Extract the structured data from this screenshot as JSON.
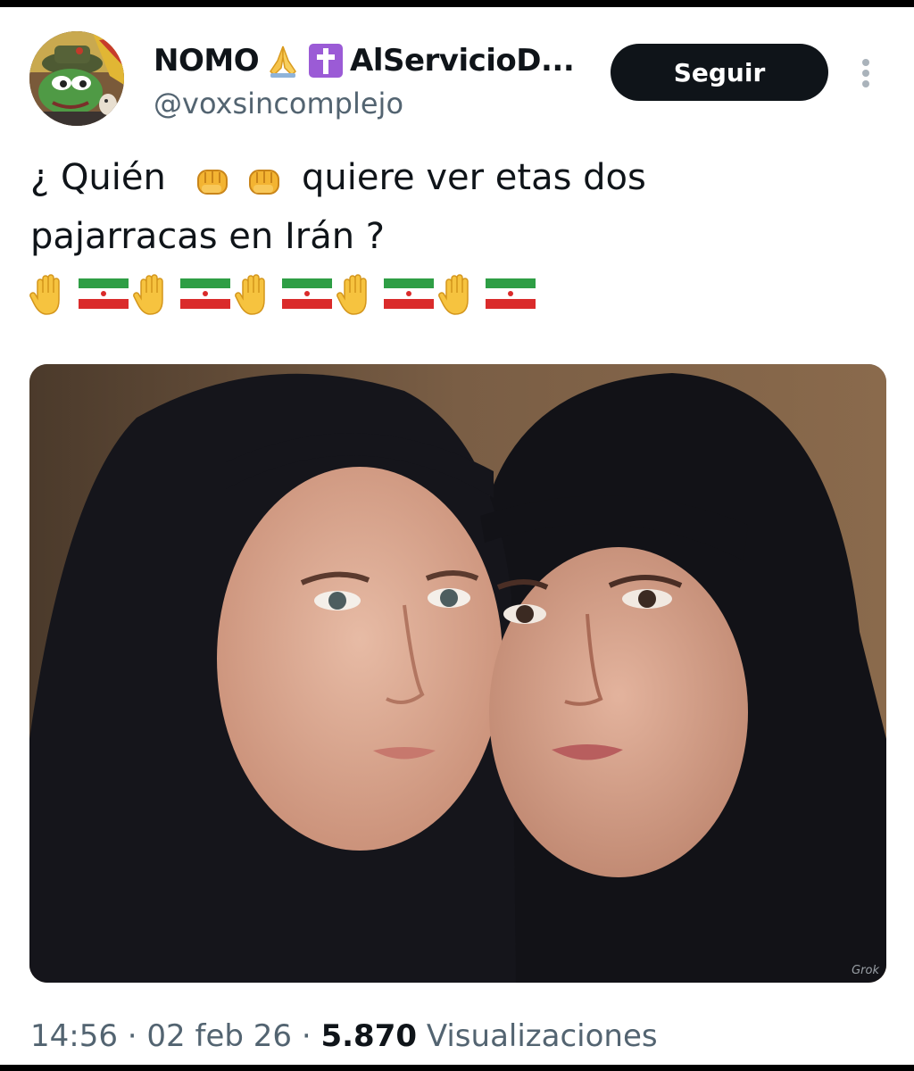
{
  "author": {
    "display_name_start": "NOMO",
    "display_name_end": "AlServicioD...",
    "handle": "@voxsincomplejo",
    "name_emojis": [
      "folded-hands-icon",
      "latin-cross-icon"
    ],
    "avatar": "pepe-frog-avatar"
  },
  "header": {
    "follow_label": "Seguir",
    "more_icon": "more-vertical-icon"
  },
  "tweet": {
    "line1_a": "¿ Quién",
    "line1_b": "quiere ver etas dos",
    "line2": "pajarracas en Irán ?",
    "line1_emojis": [
      "oncoming-fist-icon",
      "oncoming-fist-icon"
    ],
    "emoji_row": [
      "raised-hand-icon",
      "iran-flag-icon",
      "raised-hand-icon",
      "iran-flag-icon",
      "raised-hand-icon",
      "iran-flag-icon",
      "raised-hand-icon",
      "iran-flag-icon",
      "raised-hand-icon",
      "iran-flag-icon"
    ]
  },
  "media": {
    "type": "photo",
    "content": "two-women-in-black-hijabs",
    "watermark": "Grok"
  },
  "meta": {
    "time": "14:56",
    "sep1": "·",
    "date": "02 feb 26",
    "sep2": "·",
    "views_count": "5.870",
    "views_label": "Visualizaciones"
  },
  "colors": {
    "text": "#0f1419",
    "secondary": "#536471",
    "button_bg": "#0f1419",
    "button_text": "#ffffff",
    "background": "#ffffff"
  }
}
